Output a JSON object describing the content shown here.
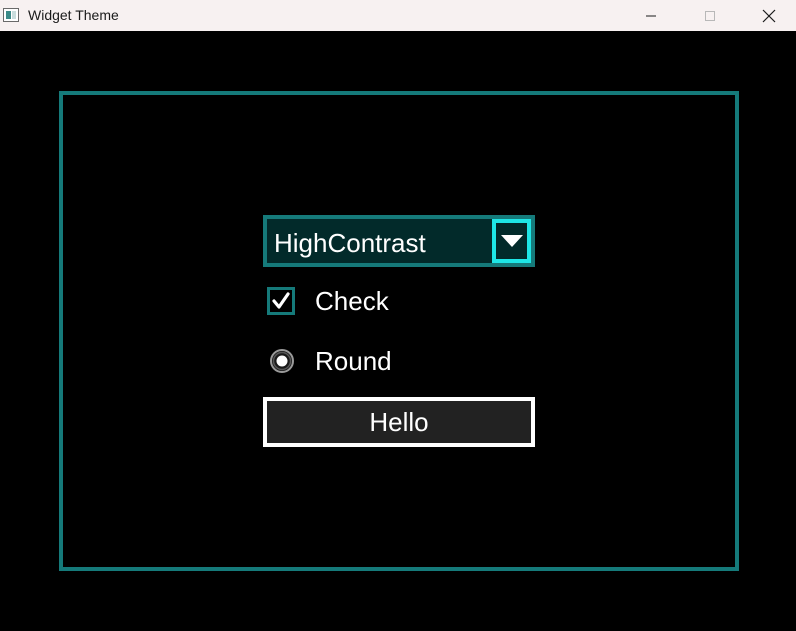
{
  "window": {
    "title": "Widget Theme",
    "icon": "app-window-icon"
  },
  "titlebar": {
    "buttons": [
      {
        "name": "minimize",
        "icon": "minimize-icon"
      },
      {
        "name": "maximize",
        "icon": "maximize-icon",
        "enabled": false
      },
      {
        "name": "close",
        "icon": "close-icon"
      }
    ]
  },
  "theme_selector": {
    "value": "HighContrast",
    "icon": "chevron-down-icon"
  },
  "checkbox": {
    "label": "Check",
    "checked": true,
    "icon": "checkmark-icon"
  },
  "radio": {
    "label": "Round",
    "selected": true
  },
  "button": {
    "label": "Hello"
  },
  "colors": {
    "background": "#000000",
    "titlebar": "#f7f1f1",
    "frame_border": "#157a7a",
    "combo_background": "#022a2a",
    "combo_arrow_border": "#1ee6e6",
    "button_background": "#222222",
    "button_border": "#ffffff",
    "text": "#ffffff"
  }
}
